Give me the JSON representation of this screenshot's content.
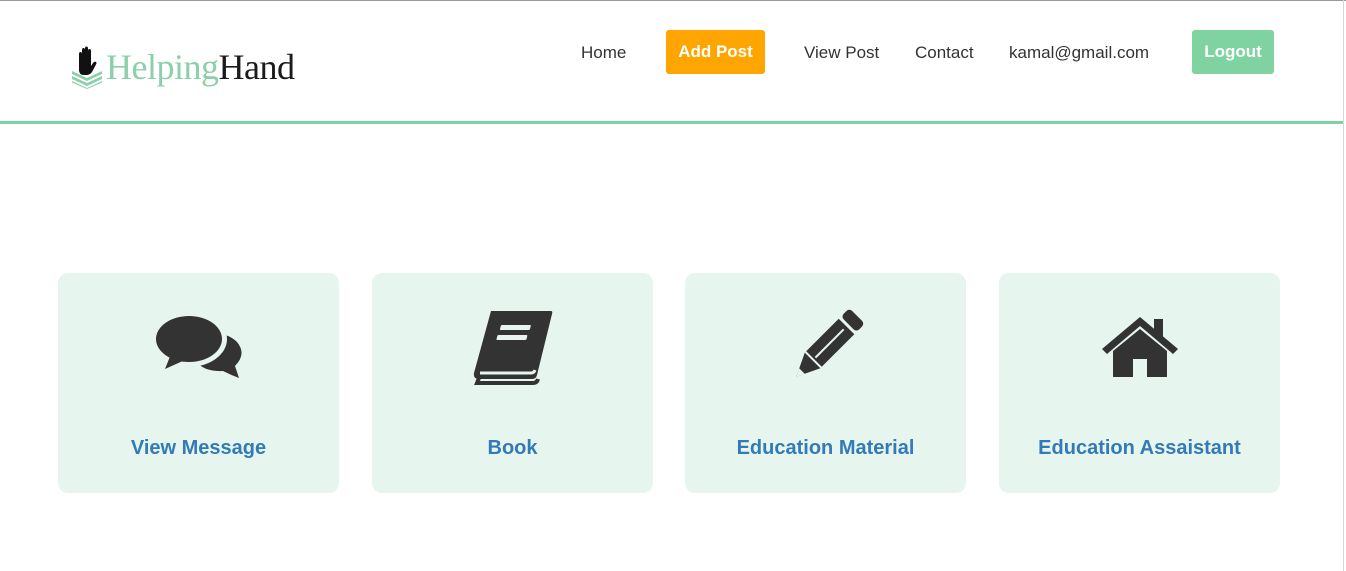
{
  "app": {
    "logo_text_part1": "Helping",
    "logo_text_part2": "Hand",
    "accent_color": "#7fd3a1",
    "add_button_color": "#ffa500",
    "card_background": "#e6f6ee",
    "card_title_color": "#337ab7"
  },
  "nav": {
    "home": "Home",
    "add_post": "Add Post",
    "view_post": "View Post",
    "contact": "Contact",
    "user_email": "kamal@gmail.com",
    "logout": "Logout"
  },
  "cards": [
    {
      "title": "View Message",
      "icon": "chat-bubbles-icon"
    },
    {
      "title": "Book",
      "icon": "book-icon"
    },
    {
      "title": "Education Material",
      "icon": "pencil-icon"
    },
    {
      "title": "Education Assaistant",
      "icon": "home-icon"
    }
  ]
}
